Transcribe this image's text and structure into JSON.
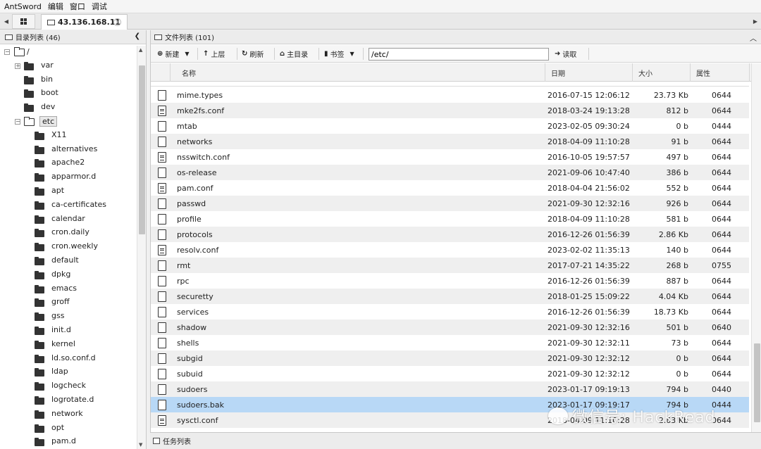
{
  "menubar": [
    "AntSword",
    "编辑",
    "窗口",
    "调试"
  ],
  "tabs": {
    "host": "43.136.168.11"
  },
  "left_panel": {
    "title": "目录列表 (46)",
    "root": "/",
    "tree": [
      {
        "label": "var",
        "depth": 1,
        "expandable": true
      },
      {
        "label": "bin",
        "depth": 1,
        "expandable": false
      },
      {
        "label": "boot",
        "depth": 1,
        "expandable": false
      },
      {
        "label": "dev",
        "depth": 1,
        "expandable": false
      },
      {
        "label": "etc",
        "depth": 1,
        "expandable": true,
        "open": true,
        "selected": true
      },
      {
        "label": "X11",
        "depth": 2
      },
      {
        "label": "alternatives",
        "depth": 2
      },
      {
        "label": "apache2",
        "depth": 2
      },
      {
        "label": "apparmor.d",
        "depth": 2
      },
      {
        "label": "apt",
        "depth": 2
      },
      {
        "label": "ca-certificates",
        "depth": 2
      },
      {
        "label": "calendar",
        "depth": 2
      },
      {
        "label": "cron.daily",
        "depth": 2
      },
      {
        "label": "cron.weekly",
        "depth": 2
      },
      {
        "label": "default",
        "depth": 2
      },
      {
        "label": "dpkg",
        "depth": 2
      },
      {
        "label": "emacs",
        "depth": 2
      },
      {
        "label": "groff",
        "depth": 2
      },
      {
        "label": "gss",
        "depth": 2
      },
      {
        "label": "init.d",
        "depth": 2
      },
      {
        "label": "kernel",
        "depth": 2
      },
      {
        "label": "ld.so.conf.d",
        "depth": 2
      },
      {
        "label": "ldap",
        "depth": 2
      },
      {
        "label": "logcheck",
        "depth": 2
      },
      {
        "label": "logrotate.d",
        "depth": 2
      },
      {
        "label": "network",
        "depth": 2
      },
      {
        "label": "opt",
        "depth": 2
      },
      {
        "label": "pam.d",
        "depth": 2
      }
    ]
  },
  "right_panel": {
    "title": "文件列表 (101)",
    "toolbar": {
      "new": "新建",
      "up": "上层",
      "refresh": "刷新",
      "home": "主目录",
      "bookmark": "书签",
      "read": "读取"
    },
    "path": "/etc/",
    "columns": [
      "名称",
      "日期",
      "大小",
      "属性"
    ],
    "files": [
      {
        "name": "mime.types",
        "date": "2016-07-15 12:06:12",
        "size": "23.73 Kb",
        "perm": "0644",
        "icon": "file"
      },
      {
        "name": "mke2fs.conf",
        "date": "2018-03-24 19:13:28",
        "size": "812 b",
        "perm": "0644",
        "icon": "text"
      },
      {
        "name": "mtab",
        "date": "2023-02-05 09:30:24",
        "size": "0 b",
        "perm": "0444",
        "icon": "file"
      },
      {
        "name": "networks",
        "date": "2018-04-09 11:10:28",
        "size": "91 b",
        "perm": "0644",
        "icon": "file"
      },
      {
        "name": "nsswitch.conf",
        "date": "2016-10-05 19:57:57",
        "size": "497 b",
        "perm": "0644",
        "icon": "text"
      },
      {
        "name": "os-release",
        "date": "2021-09-06 10:47:40",
        "size": "386 b",
        "perm": "0644",
        "icon": "file"
      },
      {
        "name": "pam.conf",
        "date": "2018-04-04 21:56:02",
        "size": "552 b",
        "perm": "0644",
        "icon": "text"
      },
      {
        "name": "passwd",
        "date": "2021-09-30 12:32:16",
        "size": "926 b",
        "perm": "0644",
        "icon": "file"
      },
      {
        "name": "profile",
        "date": "2018-04-09 11:10:28",
        "size": "581 b",
        "perm": "0644",
        "icon": "file"
      },
      {
        "name": "protocols",
        "date": "2016-12-26 01:56:39",
        "size": "2.86 Kb",
        "perm": "0644",
        "icon": "file"
      },
      {
        "name": "resolv.conf",
        "date": "2023-02-02 11:35:13",
        "size": "140 b",
        "perm": "0644",
        "icon": "text"
      },
      {
        "name": "rmt",
        "date": "2017-07-21 14:35:22",
        "size": "268 b",
        "perm": "0755",
        "icon": "file"
      },
      {
        "name": "rpc",
        "date": "2016-12-26 01:56:39",
        "size": "887 b",
        "perm": "0644",
        "icon": "file"
      },
      {
        "name": "securetty",
        "date": "2018-01-25 15:09:22",
        "size": "4.04 Kb",
        "perm": "0644",
        "icon": "file"
      },
      {
        "name": "services",
        "date": "2016-12-26 01:56:39",
        "size": "18.73 Kb",
        "perm": "0644",
        "icon": "file"
      },
      {
        "name": "shadow",
        "date": "2021-09-30 12:32:16",
        "size": "501 b",
        "perm": "0640",
        "icon": "file"
      },
      {
        "name": "shells",
        "date": "2021-09-30 12:32:11",
        "size": "73 b",
        "perm": "0644",
        "icon": "file"
      },
      {
        "name": "subgid",
        "date": "2021-09-30 12:32:12",
        "size": "0 b",
        "perm": "0644",
        "icon": "file"
      },
      {
        "name": "subuid",
        "date": "2021-09-30 12:32:12",
        "size": "0 b",
        "perm": "0644",
        "icon": "file"
      },
      {
        "name": "sudoers",
        "date": "2023-01-17 09:19:13",
        "size": "794 b",
        "perm": "0440",
        "icon": "file"
      },
      {
        "name": "sudoers.bak",
        "date": "2023-01-17 09:19:17",
        "size": "794 b",
        "perm": "0444",
        "icon": "file",
        "selected": true
      },
      {
        "name": "sysctl.conf",
        "date": "2018-04-09 11:10:28",
        "size": "2.63 Kb",
        "perm": "0644",
        "icon": "text"
      }
    ]
  },
  "bottom": {
    "task_list": "任务列表"
  },
  "watermark": "微信号: HackRead",
  "colors": {
    "selected_row": "#b8d8f6",
    "alt_row": "#efefef"
  }
}
